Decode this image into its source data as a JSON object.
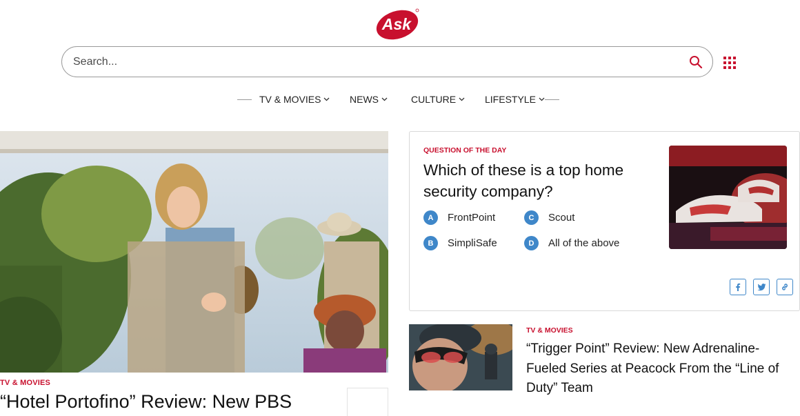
{
  "header": {
    "logo_text": "Ask",
    "brand_color": "#c8102e"
  },
  "search": {
    "placeholder": "Search...",
    "value": ""
  },
  "nav": {
    "items": [
      {
        "label": "TV & MOVIES"
      },
      {
        "label": "NEWS"
      },
      {
        "label": "CULTURE"
      },
      {
        "label": "LIFESTYLE"
      }
    ]
  },
  "hero": {
    "category": "TV & MOVIES",
    "title": "“Hotel Portofino” Review: New PBS"
  },
  "qotd": {
    "label": "QUESTION OF THE DAY",
    "question": "Which of these is a top home security company?",
    "options": [
      {
        "letter": "A",
        "text": "FrontPoint"
      },
      {
        "letter": "B",
        "text": "SimpliSafe"
      },
      {
        "letter": "C",
        "text": "Scout"
      },
      {
        "letter": "D",
        "text": "All of the above"
      }
    ],
    "badge_color": "#3f87c9"
  },
  "article": {
    "category": "TV & MOVIES",
    "title": "“Trigger Point” Review: New Adrenaline-Fueled Series at Peacock From the “Line of Duty” Team"
  },
  "icons": [
    "search-icon",
    "apps-grid-icon",
    "chevron-down-icon",
    "facebook-icon",
    "twitter-icon",
    "link-icon"
  ]
}
